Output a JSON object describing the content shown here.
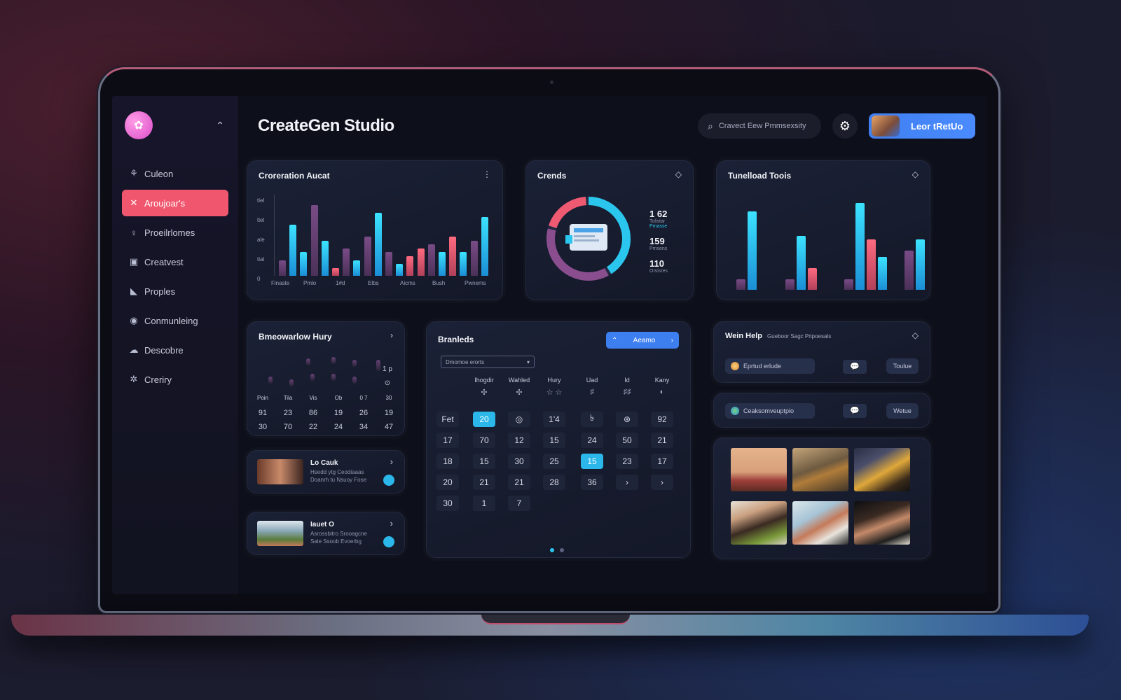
{
  "app": {
    "title": "CreateGen Studio"
  },
  "search": {
    "text": "Cravect Eew Pmmsexsity"
  },
  "user_button": {
    "label": "Leor tRetUo"
  },
  "sidebar": {
    "items": [
      {
        "label": "Culeon",
        "icon": "person-group-icon"
      },
      {
        "label": "Aroujoar's",
        "icon": "tools-icon",
        "active": true
      },
      {
        "label": "Proeilrlomes",
        "icon": "user-icon"
      },
      {
        "label": "Creatvest",
        "icon": "briefcase-icon"
      },
      {
        "label": "Proples",
        "icon": "tag-icon"
      },
      {
        "label": "Conmunleing",
        "icon": "chat-circle-icon"
      },
      {
        "label": "Descobre",
        "icon": "cloud-icon"
      },
      {
        "label": "Creriry",
        "icon": "settings-icon"
      }
    ]
  },
  "generation_card": {
    "title": "Croreration Aucat",
    "menu": "⋮",
    "y_ticks": [
      "tiel",
      "tiel",
      "ale",
      "tial",
      "0"
    ],
    "x_ticks": [
      "Finaste",
      "Pmlo",
      "1#d",
      "Elbs",
      "Aicms",
      "Bush",
      "Pwnems"
    ]
  },
  "credits_card": {
    "title": "Crends",
    "stats": [
      {
        "value": "1 62",
        "label": "Tolistar"
      },
      {
        "value": "159",
        "label": "Pmsens"
      },
      {
        "value": "110",
        "label": "Orsisres"
      }
    ],
    "sub_label": "Pmasse"
  },
  "tools_card": {
    "title": "Tunelload Toois"
  },
  "heatmap_card": {
    "title": "Bmeowarlow Hury",
    "rows": [
      [
        "Poin",
        "Tila",
        "Vis",
        "Ob",
        "0 7",
        "30"
      ],
      [
        "91",
        "23",
        "86",
        "19",
        "26",
        "19"
      ],
      [
        "30",
        "70",
        "22",
        "24",
        "34",
        "47"
      ]
    ],
    "side_numbers": [
      "1 p",
      "⊙"
    ]
  },
  "media_items": [
    {
      "title": "Lo Cauk",
      "desc1": "Hsedd ytg Ceodiaaas",
      "desc2": "Doanrh tu Nsuoy Fose"
    },
    {
      "title": "Iauet O",
      "desc1": "Asrossbitro Srooagcne",
      "desc2": "Sale Ssoob Evoerbg"
    }
  ],
  "calendar_card": {
    "title": "Branleds",
    "action_label": "Aeamo",
    "select_value": "Dmomoe erorts",
    "weekdays": [
      "Ihogdir",
      "Wahled",
      "Hury",
      "Uad",
      "Id",
      "Kany"
    ],
    "weekday_icons": [
      "✣",
      "✣",
      "☆ ☆",
      "♯",
      "♯♯",
      "◐"
    ],
    "rows": [
      [
        "Fet",
        "20",
        "◎",
        "1'4",
        "৳",
        "⊛",
        "92"
      ],
      [
        "17",
        "70",
        "12",
        "15",
        "24",
        "50",
        "21"
      ],
      [
        "18",
        "15",
        "30",
        "25",
        "15",
        "23",
        "17"
      ],
      [
        "20",
        "21",
        "21",
        "28",
        "36",
        "›",
        "›"
      ],
      [
        "30",
        "1",
        "7"
      ]
    ]
  },
  "help_card": {
    "title": "Wein Help",
    "subtitle": "Gueboor Sagc Pripoesals",
    "row1_chip": "Eprtud erlude",
    "row1_action": "Toulue",
    "row2_chip": "Ceaksomveuptpio",
    "row2_action": "Wetue"
  },
  "chart_data": [
    {
      "type": "bar",
      "title": "Croreration Aucat",
      "categories": [
        "Finaste",
        "Pmlo",
        "1#d",
        "Elbs",
        "Aicms",
        "Bush",
        "Pwnems"
      ],
      "series": [
        {
          "values": [
            0.2,
            0.65,
            0.3,
            0.9,
            0.45,
            0.1,
            0.35,
            0.2,
            0.5,
            0.8,
            0.3,
            0.15,
            0.25,
            0.35,
            0.4,
            0.3,
            0.5,
            0.3,
            0.45,
            0.75
          ]
        }
      ]
    },
    {
      "type": "bar",
      "title": "Tunelload Toois",
      "series": [
        {
          "values": [
            0.12,
            0.9,
            0.12,
            0.62,
            0.25,
            0.12,
            1.0,
            0.58,
            0.38,
            0.45,
            0.58
          ]
        }
      ]
    },
    {
      "type": "pie",
      "title": "Crends",
      "slices": [
        0.42,
        0.38,
        0.2
      ]
    }
  ],
  "colors": {
    "accent": "#f0576e",
    "cyan": "#2bb7ea",
    "primary": "#4a8bff"
  }
}
